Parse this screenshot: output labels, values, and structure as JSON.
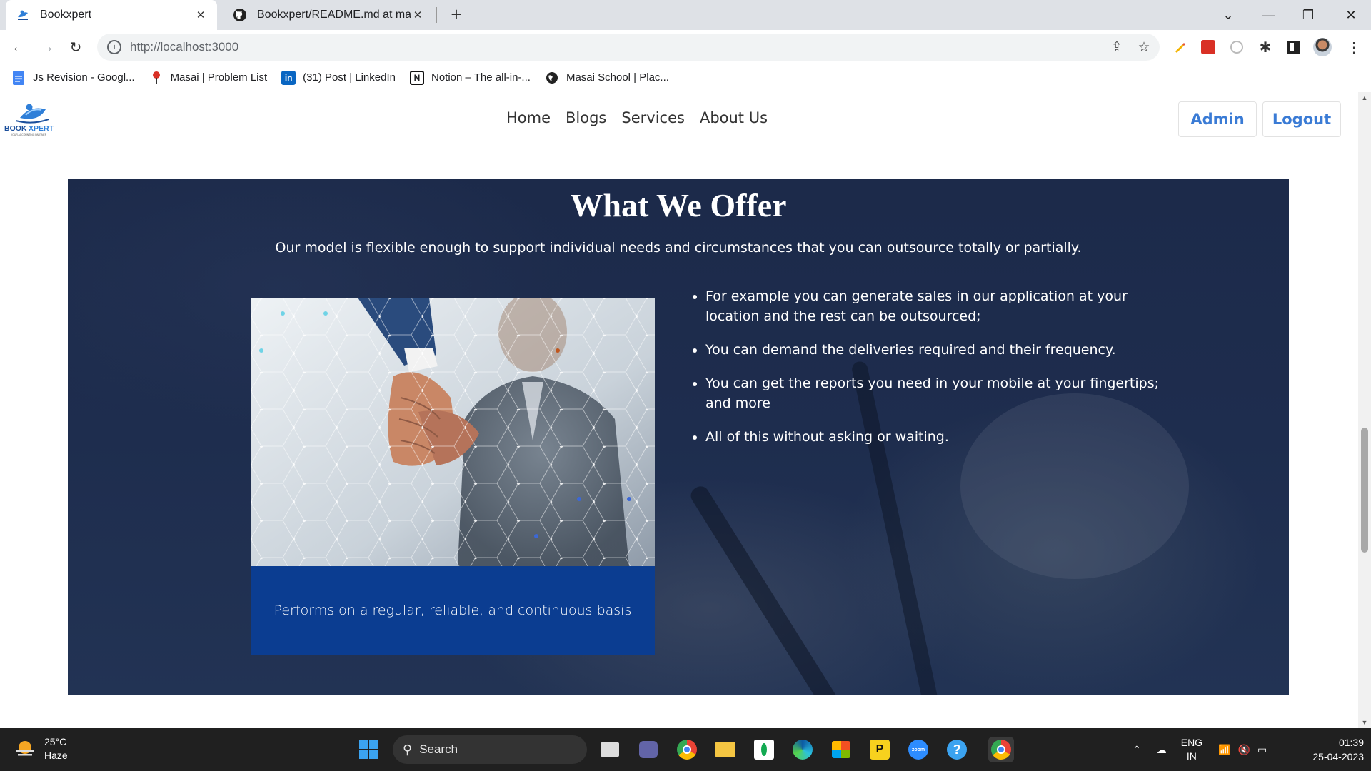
{
  "browser": {
    "tabs": [
      {
        "title": "Bookxpert",
        "active": true
      },
      {
        "title": "Bookxpert/README.md at main · ",
        "active": false
      }
    ],
    "url": "http://localhost:3000",
    "bookmarks": [
      {
        "label": "Js Revision - Googl...",
        "icon": "docs-icon"
      },
      {
        "label": "Masai | Problem List",
        "icon": "masai-icon"
      },
      {
        "label": "(31) Post | LinkedIn",
        "icon": "linkedin-icon"
      },
      {
        "label": "Notion – The all-in-...",
        "icon": "notion-icon"
      },
      {
        "label": "Masai School | Plac...",
        "icon": "globe-icon"
      }
    ]
  },
  "site": {
    "logo_text": "BOOK XPERT",
    "logo_tagline": "YOUR ACCOUNTING PARTNER",
    "nav": [
      "Home",
      "Blogs",
      "Services",
      "About Us"
    ],
    "admin_label": "Admin",
    "logout_label": "Logout",
    "accent": "#3a7bd5"
  },
  "offer": {
    "title": "What We Offer",
    "subtitle": "Our model is flexible enough to support individual needs and circumstances that you can outsource totally or partially.",
    "caption": "Performs on a regular, reliable, and continuous basis",
    "bullets": [
      "For example you can generate sales in our application at your location and the rest can be outsourced;",
      "You can demand the deliveries required and their frequency.",
      "You can get the reports you need in your mobile at your fingertips; and more",
      "All of this without asking or waiting."
    ],
    "background": "#1e2d4e",
    "caption_bg": "#0b3d91"
  },
  "taskbar": {
    "temperature": "25°C",
    "weather": "Haze",
    "search_label": "Search",
    "lang_top": "ENG",
    "lang_bottom": "IN",
    "time": "01:39",
    "date": "25-04-2023"
  }
}
